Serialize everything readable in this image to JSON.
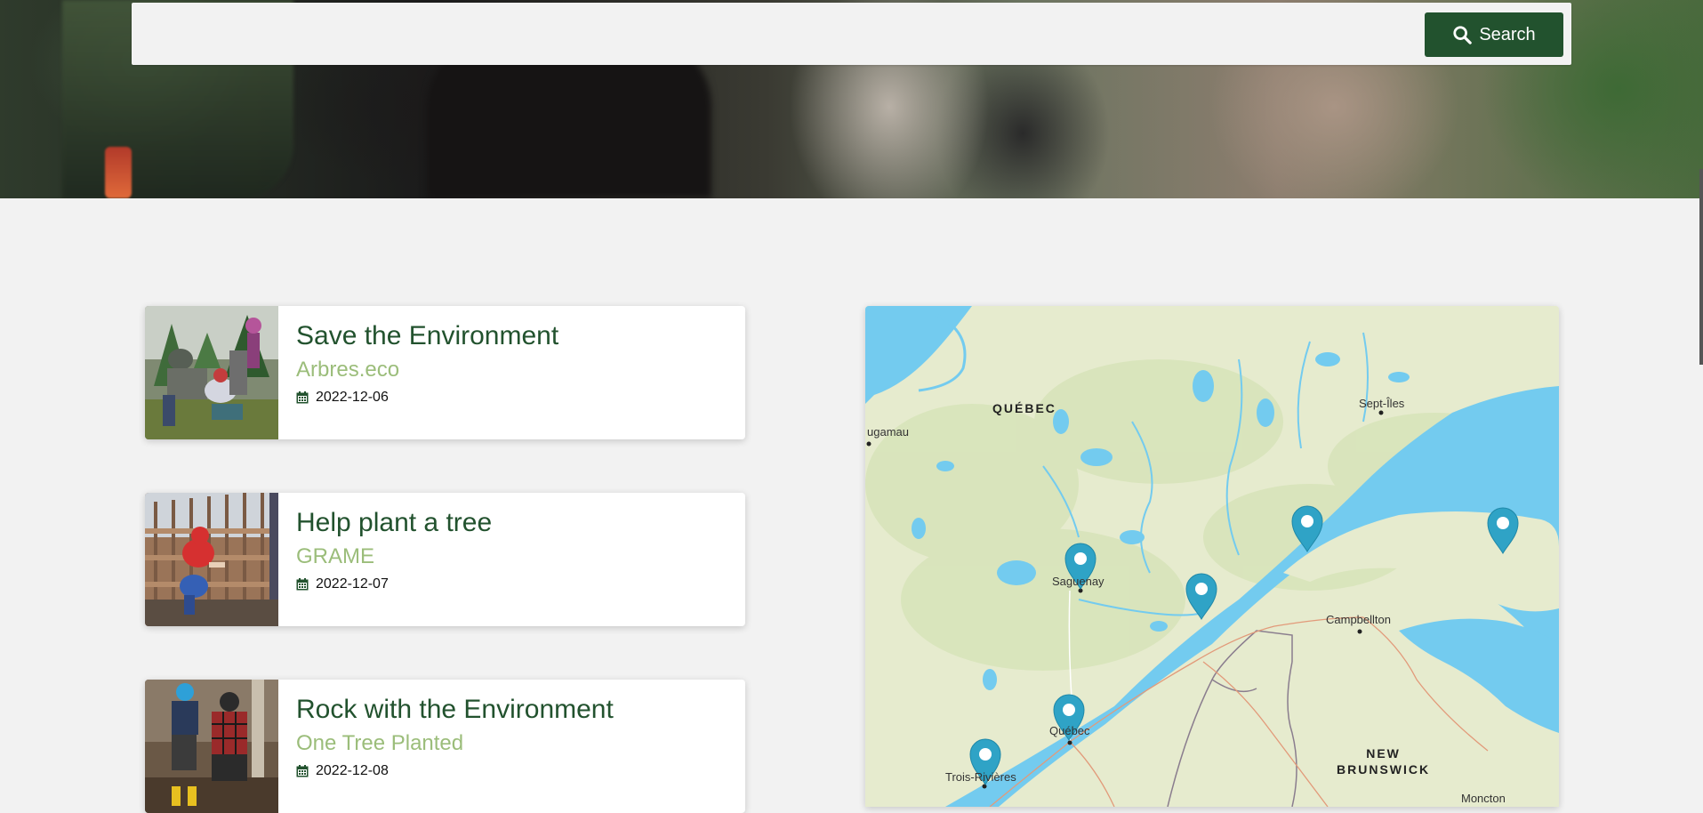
{
  "search": {
    "placeholder": "",
    "value": "",
    "button_label": "Search"
  },
  "events": [
    {
      "title": "Save the Environment",
      "organization": "Arbres.eco",
      "date": "2022-12-06"
    },
    {
      "title": "Help plant a tree",
      "organization": "GRAME",
      "date": "2022-12-07"
    },
    {
      "title": "Rock with the Environment",
      "organization": "One Tree Planted",
      "date": "2022-12-08"
    }
  ],
  "map": {
    "labels": {
      "quebec_region": "QUÉBEC",
      "sept_iles": "Sept-Îles",
      "chibougamau": "ugamau",
      "saguenay": "Saguenay",
      "campbellton": "Campbellton",
      "quebec_city": "Québec",
      "trois_rivieres": "Trois-Rivières",
      "new_brunswick_1": "NEW",
      "new_brunswick_2": "BRUNSWICK",
      "moncton": "Moncton"
    },
    "marker_count": 6
  },
  "colors": {
    "primary": "#22522e",
    "accent": "#9bbd7a",
    "marker": "#2fa3c6",
    "water": "#73cbef",
    "land": "#e6ebce"
  }
}
